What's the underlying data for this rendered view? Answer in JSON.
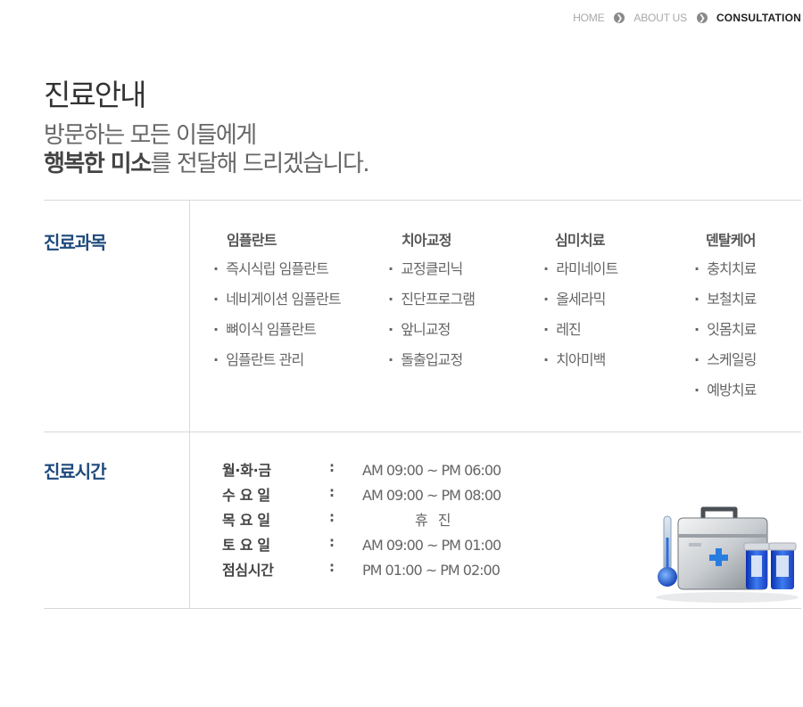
{
  "breadcrumb": {
    "items": [
      {
        "label": "HOME"
      },
      {
        "label": "ABOUT US"
      },
      {
        "label": "CONSULTATION"
      }
    ],
    "separator_icon": "chevron-right-circle-icon"
  },
  "page_title": "진료안내",
  "subtitle": {
    "line1": "방문하는 모든 이들에게",
    "line2_bold": "행복한 미소",
    "line2_rest": "를 전달해 드리겠습니다."
  },
  "departments": {
    "title": "진료과목",
    "columns": [
      {
        "heading": "임플란트",
        "items": [
          "즉시식립 임플란트",
          "네비게이션 임플란트",
          "뼈이식 임플란트",
          "임플란트 관리"
        ]
      },
      {
        "heading": "치아교정",
        "items": [
          "교정클리닉",
          "진단프로그램",
          "앞니교정",
          "돌출입교정"
        ]
      },
      {
        "heading": "심미치료",
        "items": [
          "라미네이트",
          "올세라믹",
          "레진",
          "치아미백"
        ]
      },
      {
        "heading": "덴탈케어",
        "items": [
          "충치치료",
          "보철치료",
          "잇몸치료",
          "스케일링",
          "예방치료"
        ]
      }
    ]
  },
  "hours": {
    "title": "진료시간",
    "separator": ":",
    "rows": [
      {
        "day": "월·화·금",
        "time": "AM 09:00 ~ PM 06:00"
      },
      {
        "day": "수 요 일",
        "time": "AM 09:00 ~ PM 08:00"
      },
      {
        "day": "목 요 일",
        "time": "휴 진"
      },
      {
        "day": "토 요 일",
        "time": "AM 09:00 ~ PM 01:00"
      },
      {
        "day": "점심시간",
        "time": "PM 01:00 ~ PM 02:00"
      }
    ]
  },
  "illustration": {
    "icon": "medical-kit-icon"
  },
  "colors": {
    "section_title": "#1f4a7c",
    "breadcrumb_active": "#222222",
    "breadcrumb_inactive": "#a8a8a8",
    "divider": "#d8d8d8"
  }
}
